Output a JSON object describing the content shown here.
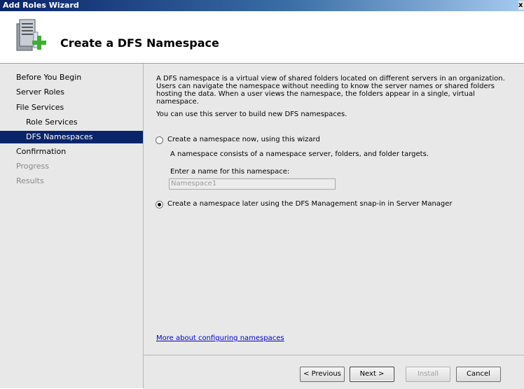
{
  "window": {
    "title": "Add Roles Wizard",
    "close_glyph": "x"
  },
  "header": {
    "title": "Create a DFS Namespace",
    "icon": "server-add-icon"
  },
  "nav": {
    "items": [
      {
        "label": "Before You Begin",
        "state": "normal",
        "level": 0
      },
      {
        "label": "Server Roles",
        "state": "normal",
        "level": 0
      },
      {
        "label": "File Services",
        "state": "normal",
        "level": 0
      },
      {
        "label": "Role Services",
        "state": "normal",
        "level": 1
      },
      {
        "label": "DFS Namespaces",
        "state": "active",
        "level": 1
      },
      {
        "label": "Confirmation",
        "state": "normal",
        "level": 0
      },
      {
        "label": "Progress",
        "state": "disabled",
        "level": 0
      },
      {
        "label": "Results",
        "state": "disabled",
        "level": 0
      }
    ]
  },
  "content": {
    "description": "A DFS namespace is a virtual view of shared folders located on different servers in an organization. Users can navigate the namespace without needing to know the server names or shared folders hosting the data. When a user views the namespace, the folders appear in a single, virtual namespace.",
    "build_text": "You can use this server to build new DFS namespaces.",
    "option_now": {
      "label": "Create a namespace now, using this wizard",
      "selected": false
    },
    "option_now_desc": "A namespace consists of a namespace server, folders, and folder targets.",
    "name_label": "Enter a name for this namespace:",
    "name_value": "Namespace1",
    "option_later": {
      "label": "Create a namespace later using the DFS Management snap-in in Server Manager",
      "selected": true
    },
    "more_link": "More about configuring namespaces"
  },
  "buttons": {
    "previous": "< Previous",
    "next": "Next >",
    "install": "Install",
    "cancel": "Cancel"
  }
}
